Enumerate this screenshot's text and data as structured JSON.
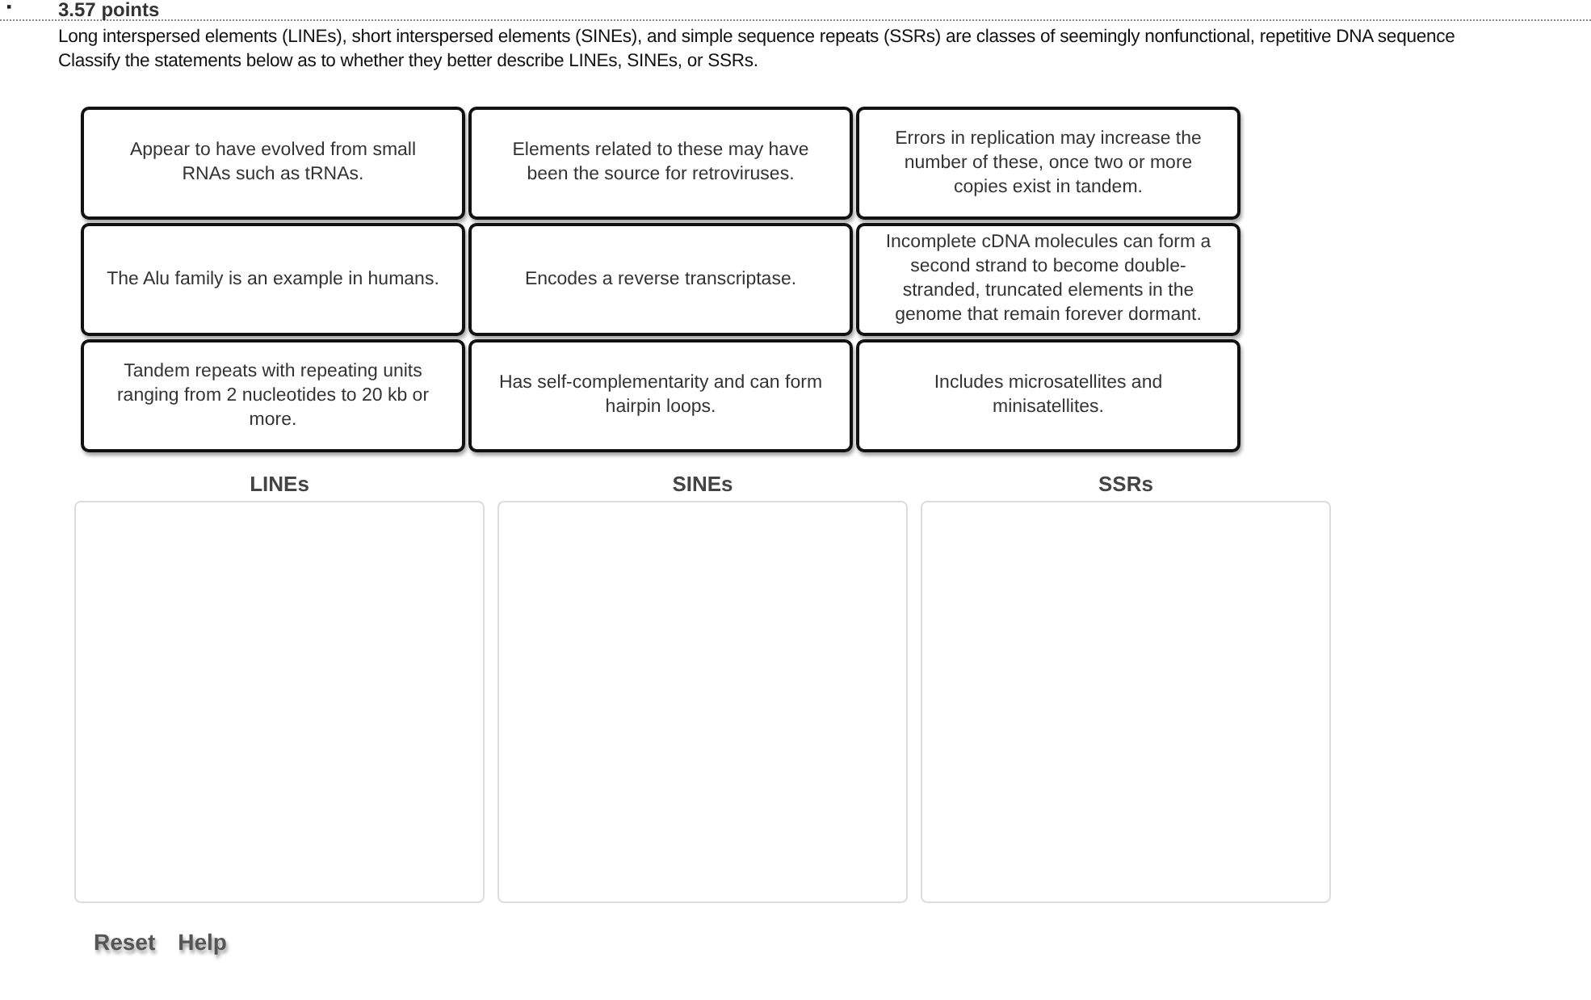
{
  "question": {
    "bullet": "▪",
    "points": "3.57 points",
    "prompt": [
      "Long interspersed elements (LINEs), short interspersed elements (SINEs), and simple sequence repeats (SSRs) are classes of seemingly nonfunctional, repetitive DNA sequence",
      "Classify the statements below as to whether they better describe LINEs, SINEs, or SSRs."
    ]
  },
  "cards": [
    {
      "text": "Appear to have evolved from small RNAs such as tRNAs."
    },
    {
      "text": "Elements related to these may have been the source for retroviruses."
    },
    {
      "text": "Errors in replication may increase the number of these, once two or more copies exist in tandem."
    },
    {
      "text": "The Alu family is an example in humans."
    },
    {
      "text": "Encodes a reverse transcriptase."
    },
    {
      "text": "Incomplete cDNA molecules can form a second strand to become double-stranded, truncated elements in the genome that remain forever dormant."
    },
    {
      "text": "Tandem repeats with repeating units ranging from 2 nucleotides to 20 kb or more."
    },
    {
      "text": "Has self-complementarity and can form hairpin loops."
    },
    {
      "text": "Includes microsatellites and minisatellites."
    }
  ],
  "bins": [
    {
      "label": "LINEs"
    },
    {
      "label": "SINEs"
    },
    {
      "label": "SSRs"
    }
  ],
  "buttons": [
    "Reset",
    "Help"
  ]
}
